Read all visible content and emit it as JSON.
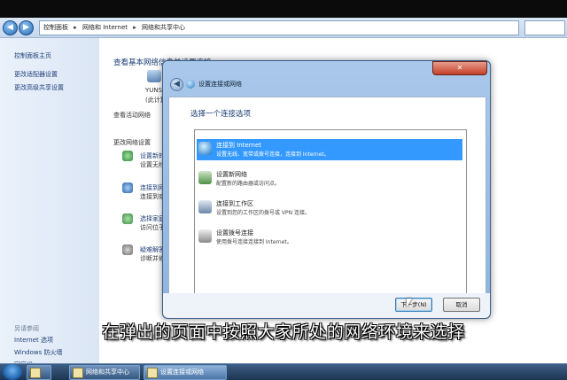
{
  "address_bar": {
    "breadcrumb": [
      "控制面板",
      "网络和 Internet",
      "网络和共享中心"
    ]
  },
  "sidebar": {
    "home": "控制面板主页",
    "links": [
      "更改适配器设置",
      "更改高级共享设置"
    ],
    "see_also_label": "另请参阅",
    "see_also": [
      "Internet 选项",
      "Windows 防火墙",
      "家庭组"
    ]
  },
  "content": {
    "heading_partial": "查看基本网络信息并设置连接",
    "computer_name": "YUNSE",
    "computer_sub": "(此计算机)",
    "active_networks": "查看活动网络",
    "change_settings": "更改网络设置",
    "tasks": [
      {
        "title": "设置新的",
        "desc": "设置无线"
      },
      {
        "title": "连接到网",
        "desc": "连接到或"
      },
      {
        "title": "选择家庭",
        "desc": "访问位于"
      },
      {
        "title": "疑难解答",
        "desc": "诊断并修"
      }
    ]
  },
  "dialog": {
    "title": "设置连接或网络",
    "close_glyph": "✕",
    "heading": "选择一个连接选项",
    "options": [
      {
        "title": "连接到 Internet",
        "desc": "设置无线、宽带或拨号连接，连接到 Internet。",
        "icon": "globe-icon",
        "selected": true
      },
      {
        "title": "设置新网络",
        "desc": "配置新的路由器或访问点。",
        "icon": "router-icon",
        "selected": false
      },
      {
        "title": "连接到工作区",
        "desc": "设置到您的工作区的拨号或 VPN 连接。",
        "icon": "workplace-icon",
        "selected": false
      },
      {
        "title": "设置拨号连接",
        "desc": "使用拨号连接连接到 Internet。",
        "icon": "dialup-icon",
        "selected": false
      }
    ],
    "next_button": "下一步(N)",
    "cancel_button": "取消"
  },
  "taskbar": {
    "items": [
      "网络和共享中心",
      "设置连接或网络"
    ]
  },
  "caption": "在弹出的页面中按照大家所处的网络环境来选择",
  "colors": {
    "selection": "#3399ff",
    "dialog_frame": "#8fb3dc",
    "taskbar": "#1c3552"
  }
}
